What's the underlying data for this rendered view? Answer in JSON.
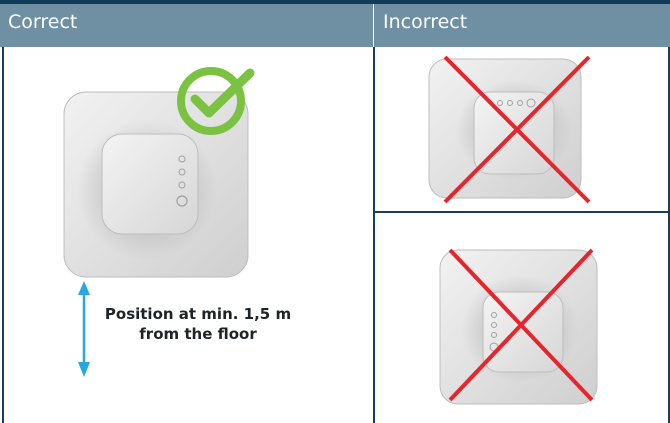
{
  "header": {
    "correct_label": "Correct",
    "incorrect_label": "Incorrect"
  },
  "caption": {
    "line1": "Position at min. 1,5 m",
    "line2": "from the floor"
  },
  "colors": {
    "header_bg": "#6f8fa3",
    "header_border": "#0f3b58",
    "check_green": "#7cc242",
    "cross_red": "#e8242b",
    "arrow_blue": "#27a8e0"
  },
  "icons": {
    "correct": "checkmark-icon",
    "incorrect": "cross-icon",
    "height": "double-arrow-icon"
  }
}
